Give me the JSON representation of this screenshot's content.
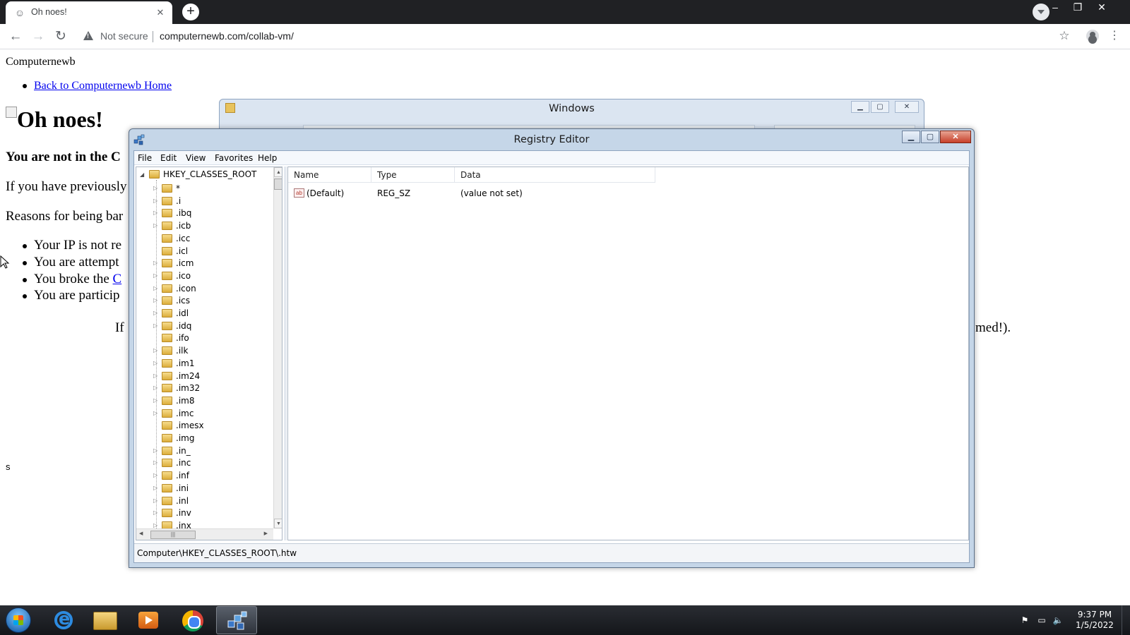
{
  "browser": {
    "tab_title": "Oh noes!",
    "not_secure": "Not secure",
    "url": "computernewb.com/collab-vm/"
  },
  "page": {
    "site_name": "Computernewb",
    "home_link": "Back to Computernewb Home",
    "headline": "Oh noes!",
    "bold_line": "You are not in the C",
    "para1": "If you have previously",
    "para2": "Reasons for being bar",
    "reasons": [
      {
        "text": "Your IP is not re",
        "link": ""
      },
      {
        "text": "You are attempt",
        "link": ""
      },
      {
        "text": "You broke the ",
        "link": "C"
      },
      {
        "text": "You are particip",
        "link": ""
      }
    ],
    "center_fragment_left": "If",
    "center_fragment_right": "med!).",
    "stray_text": "s"
  },
  "explorer_window": {
    "title": "Windows"
  },
  "regedit": {
    "title": "Registry Editor",
    "menu": [
      "File",
      "Edit",
      "View",
      "Favorites",
      "Help"
    ],
    "tree_root": "HKEY_CLASSES_ROOT",
    "tree_items": [
      {
        "label": "*",
        "expandable": true
      },
      {
        "label": ".i",
        "expandable": true
      },
      {
        "label": ".ibq",
        "expandable": true
      },
      {
        "label": ".icb",
        "expandable": true
      },
      {
        "label": ".icc",
        "expandable": false
      },
      {
        "label": ".icl",
        "expandable": false
      },
      {
        "label": ".icm",
        "expandable": true
      },
      {
        "label": ".ico",
        "expandable": true
      },
      {
        "label": ".icon",
        "expandable": true
      },
      {
        "label": ".ics",
        "expandable": true
      },
      {
        "label": ".idl",
        "expandable": true
      },
      {
        "label": ".idq",
        "expandable": true
      },
      {
        "label": ".ifo",
        "expandable": false
      },
      {
        "label": ".ilk",
        "expandable": true
      },
      {
        "label": ".im1",
        "expandable": true
      },
      {
        "label": ".im24",
        "expandable": true
      },
      {
        "label": ".im32",
        "expandable": true
      },
      {
        "label": ".im8",
        "expandable": true
      },
      {
        "label": ".imc",
        "expandable": true
      },
      {
        "label": ".imesx",
        "expandable": false
      },
      {
        "label": ".img",
        "expandable": false
      },
      {
        "label": ".in_",
        "expandable": true
      },
      {
        "label": ".inc",
        "expandable": true
      },
      {
        "label": ".inf",
        "expandable": true
      },
      {
        "label": ".ini",
        "expandable": true
      },
      {
        "label": ".inl",
        "expandable": true
      },
      {
        "label": ".inv",
        "expandable": true
      },
      {
        "label": ".inx",
        "expandable": true
      }
    ],
    "columns": [
      "Name",
      "Type",
      "Data"
    ],
    "values": [
      {
        "name": "(Default)",
        "type": "REG_SZ",
        "data": "(value not set)",
        "icon": "string-value-icon"
      }
    ],
    "status_path": "Computer\\HKEY_CLASSES_ROOT\\.htw"
  },
  "taskbar": {
    "time": "9:37 PM",
    "date": "1/5/2022",
    "pinned": [
      "internet-explorer",
      "windows-explorer",
      "media-player",
      "chrome",
      "registry-editor"
    ],
    "active": "registry-editor"
  }
}
